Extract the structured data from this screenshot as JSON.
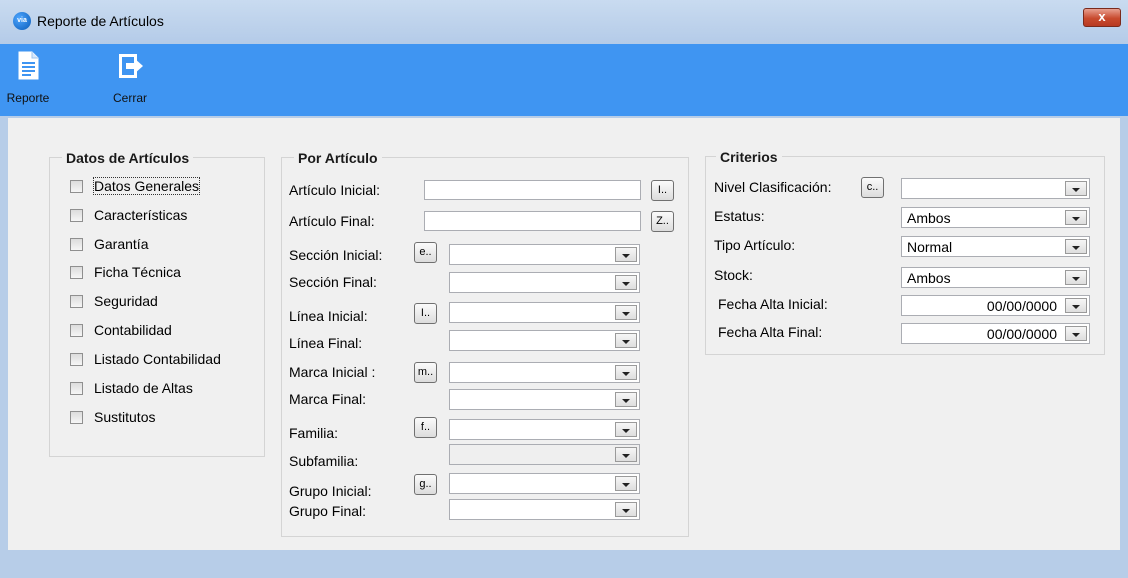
{
  "window": {
    "title": "Reporte de Artículos",
    "app_icon_text": "via",
    "close_label": "x"
  },
  "toolbar": {
    "reporte_label": "Reporte",
    "cerrar_label": "Cerrar"
  },
  "datos_articulos": {
    "title": "Datos de Artículos",
    "items": [
      {
        "label": "Datos Generales",
        "checked": false
      },
      {
        "label": "Características",
        "checked": false
      },
      {
        "label": "Garantía",
        "checked": false
      },
      {
        "label": "Ficha Técnica",
        "checked": false
      },
      {
        "label": "Seguridad",
        "checked": false
      },
      {
        "label": "Contabilidad",
        "checked": false
      },
      {
        "label": "Listado Contabilidad",
        "checked": false
      },
      {
        "label": "Listado de Altas",
        "checked": false
      },
      {
        "label": "Sustitutos",
        "checked": false
      }
    ]
  },
  "por_articulo": {
    "title": "Por Artículo",
    "articulo_inicial": {
      "label": "Artículo Inicial:",
      "value": "",
      "button": "I.."
    },
    "articulo_final": {
      "label": "Artículo Final:",
      "value": "",
      "button": "Z.."
    },
    "seccion_inicial": {
      "label": "Sección Inicial:",
      "value": "",
      "button": "e.."
    },
    "seccion_final": {
      "label": "Sección Final:",
      "value": ""
    },
    "linea_inicial": {
      "label": "Línea Inicial:",
      "value": "",
      "button": "I.."
    },
    "linea_final": {
      "label": "Línea Final:",
      "value": ""
    },
    "marca_inicial": {
      "label": "Marca Inicial :",
      "value": "",
      "button": "m.."
    },
    "marca_final": {
      "label": "Marca Final:",
      "value": ""
    },
    "familia": {
      "label": "Familia:",
      "value": "",
      "button": "f.."
    },
    "subfamilia": {
      "label": "Subfamilia:",
      "value": ""
    },
    "grupo_inicial": {
      "label": "Grupo Inicial:",
      "value": "",
      "button": "g.."
    },
    "grupo_final": {
      "label": "Grupo Final:",
      "value": ""
    }
  },
  "criterios": {
    "title": "Criterios",
    "nivel_clasificacion": {
      "label": "Nivel Clasificación:",
      "value": "",
      "button": "c.."
    },
    "estatus": {
      "label": "Estatus:",
      "value": "Ambos"
    },
    "tipo_articulo": {
      "label": "Tipo Artículo:",
      "value": "Normal"
    },
    "stock": {
      "label": "Stock:",
      "value": "Ambos"
    },
    "fecha_alta_inicial": {
      "label": "Fecha Alta Inicial:",
      "value": "00/00/0000"
    },
    "fecha_alta_final": {
      "label": "Fecha Alta Final:",
      "value": "00/00/0000"
    }
  },
  "colors": {
    "toolbar": "#3f95f2",
    "client": "#f0f0f0",
    "frame": "#b7cde8",
    "close": "#c84a2e"
  }
}
